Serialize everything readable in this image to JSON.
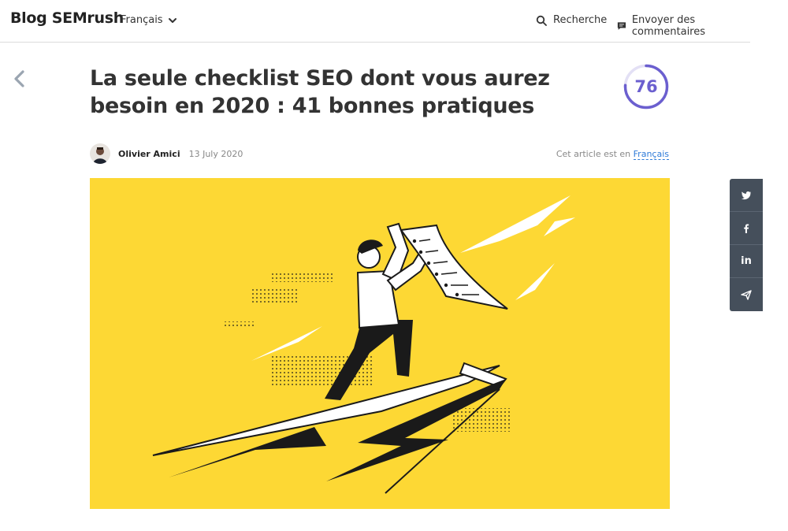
{
  "header": {
    "brand": "Blog SEMrush",
    "language": "Français",
    "search_label": "Recherche",
    "feedback_label": "Envoyer des commentaires"
  },
  "article": {
    "title": "La seule checklist SEO dont vous aurez besoin en 2020 : 41 bonnes pratiques",
    "score": "76",
    "author": "Olivier Amici",
    "date": "13 July 2020",
    "language_note": "Cet article est en",
    "language_link": "Français"
  },
  "share": {
    "linkedin_label": "in"
  },
  "icons": [
    "chevron-down-icon",
    "search-icon",
    "feedback-icon",
    "back-arrow-icon",
    "twitter-icon",
    "facebook-icon",
    "linkedin-icon",
    "send-icon"
  ],
  "colors": {
    "accent": "#6b5fcf",
    "hero_bg": "#fdd834",
    "share_bg": "#454f5b",
    "link": "#2f7bd8"
  }
}
